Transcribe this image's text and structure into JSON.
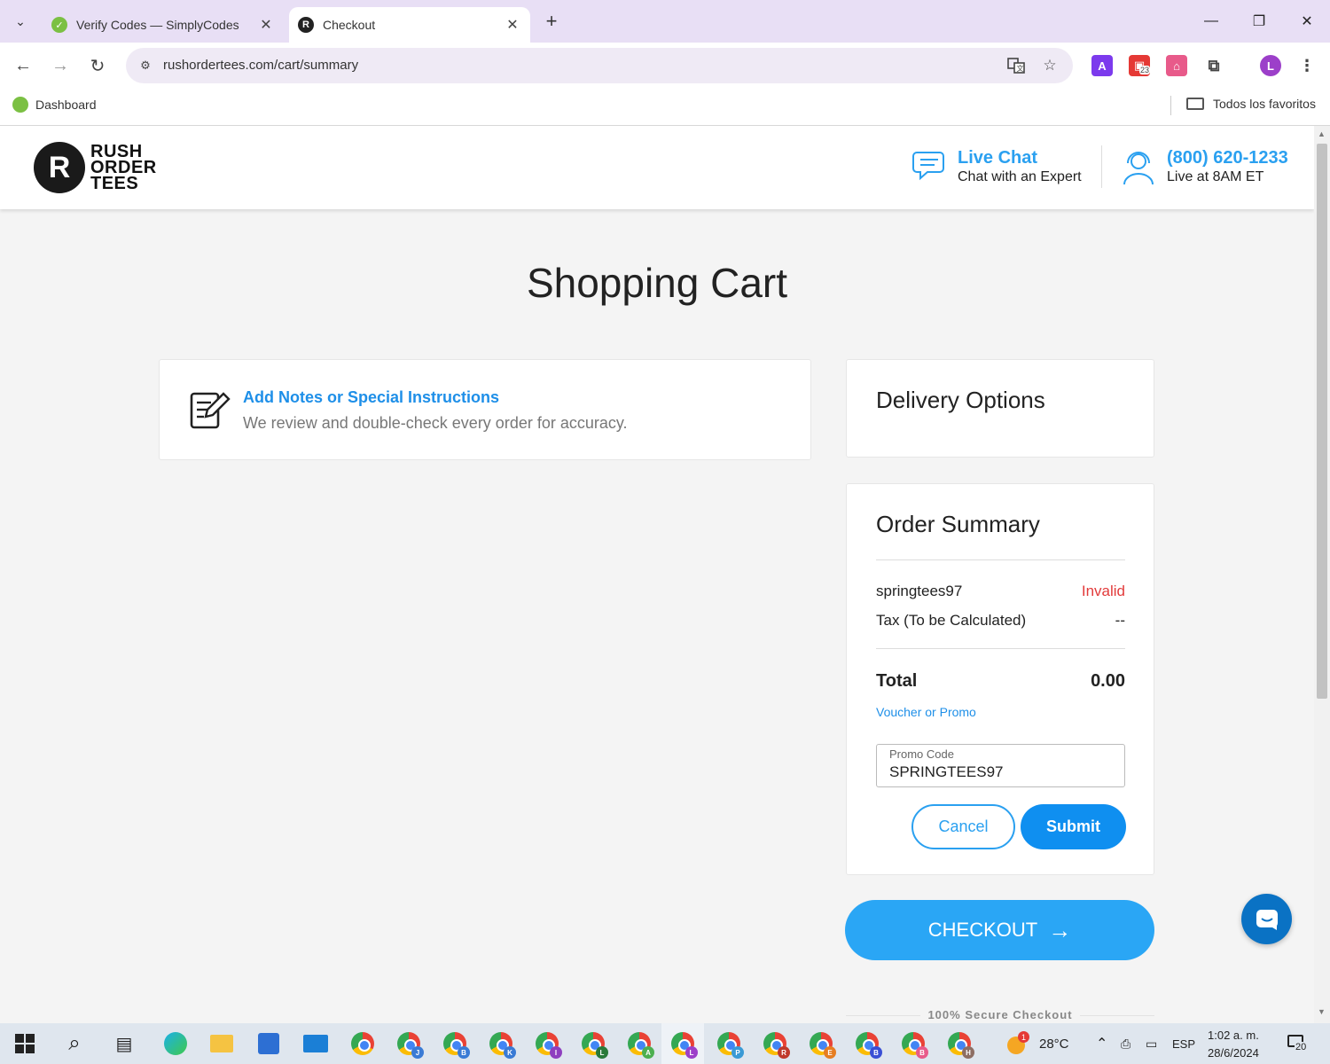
{
  "browser": {
    "tabs": [
      {
        "title": "Verify Codes — SimplyCodes",
        "active": false
      },
      {
        "title": "Checkout",
        "active": true
      }
    ],
    "url": "rushordertees.com/cart/summary",
    "profile_initial": "L",
    "extension_badge": "23",
    "bookmarks": [
      {
        "label": "Dashboard"
      }
    ],
    "favorites_folder": "Todos los favoritos"
  },
  "site": {
    "logo_lines": [
      "RUSH",
      "ORDER",
      "TEES"
    ],
    "logo_mark": "R",
    "live_chat_title": "Live Chat",
    "live_chat_sub": "Chat with an Expert",
    "phone": "(800) 620-1233",
    "phone_sub": "Live at 8AM ET"
  },
  "page": {
    "title": "Shopping Cart",
    "notes": {
      "title": "Add Notes or Special Instructions",
      "subtitle": "We review and double-check every order for accuracy."
    },
    "delivery": {
      "heading": "Delivery Options"
    },
    "summary": {
      "heading": "Order Summary",
      "promo_row": {
        "label": "springtees97",
        "status": "Invalid"
      },
      "tax_row": {
        "label": "Tax (To be Calculated)",
        "value": "--"
      },
      "total": {
        "label": "Total",
        "value": "0.00"
      },
      "voucher_link": "Voucher or Promo",
      "promo_field": {
        "label": "Promo Code",
        "value": "SPRINGTEES97"
      },
      "cancel_label": "Cancel",
      "submit_label": "Submit"
    },
    "checkout_label": "CHECKOUT",
    "secure_label": "100% Secure Checkout"
  },
  "taskbar": {
    "weather": "28°C",
    "weather_badge": "1",
    "language": "ESP",
    "time": "1:02 a. m.",
    "date": "28/6/2024",
    "notifications": "20",
    "chrome_profiles": [
      "J",
      "B",
      "K",
      "I",
      "L",
      "A",
      "L",
      "P",
      "R",
      "E",
      "B",
      "B",
      "H"
    ]
  },
  "colors": {
    "accent": "#2aa0f0",
    "error": "#e23b3b",
    "tab_bar": "#e8dff5"
  }
}
